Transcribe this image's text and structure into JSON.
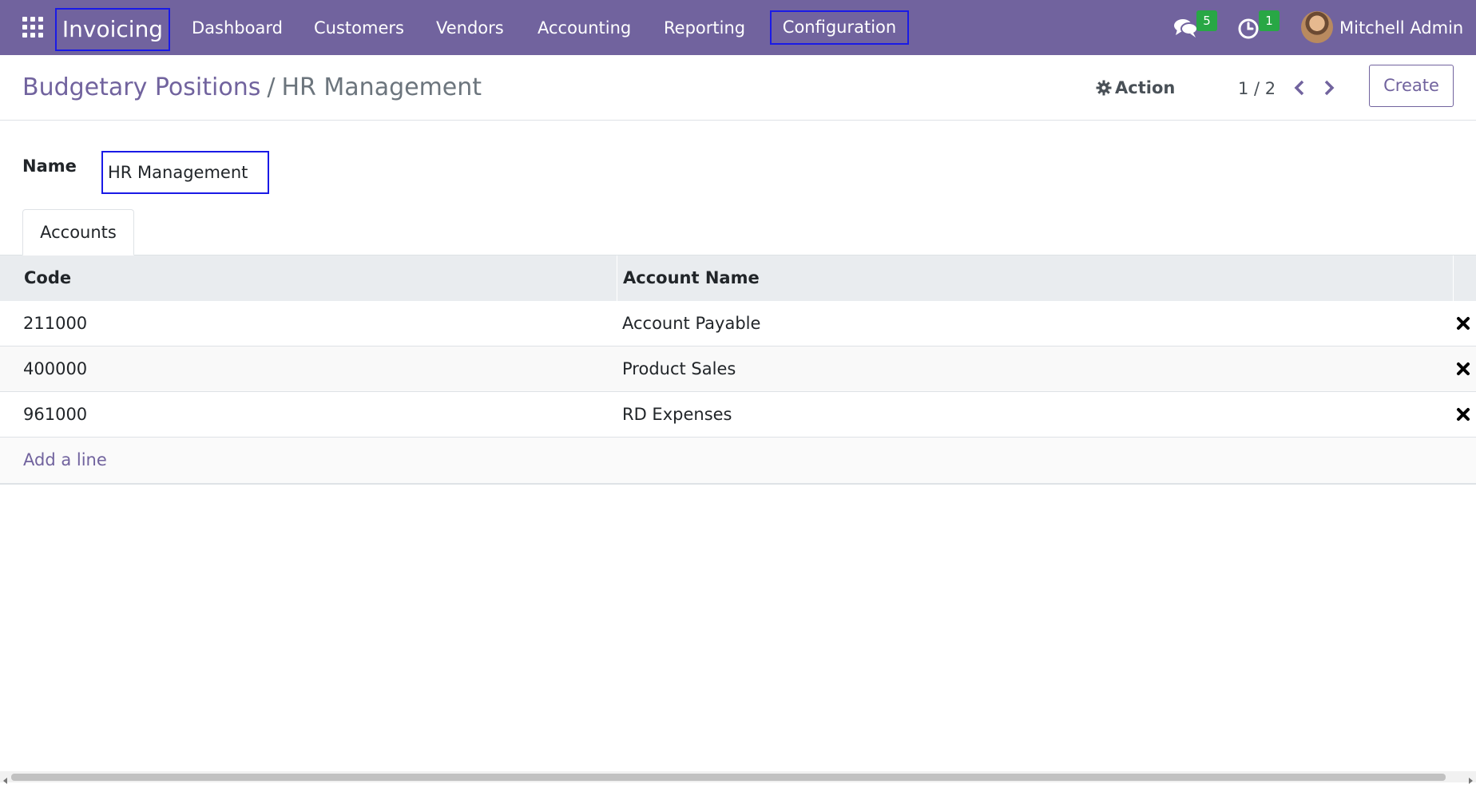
{
  "navbar": {
    "app_name": "Invoicing",
    "menu": [
      "Dashboard",
      "Customers",
      "Vendors",
      "Accounting",
      "Reporting",
      "Configuration"
    ],
    "messages_count": "5",
    "activities_count": "1",
    "user_name": "Mitchell Admin",
    "icons": [
      "apps-grid-icon",
      "chat-icon",
      "clock-icon",
      "avatar"
    ]
  },
  "control_panel": {
    "breadcrumb_parent": "Budgetary Positions",
    "breadcrumb_separator": "/",
    "breadcrumb_current": "HR Management",
    "action_label": "Action",
    "pager": "1 / 2",
    "create_label": "Create"
  },
  "form": {
    "name_label": "Name",
    "name_value": "HR Management",
    "tab_label": "Accounts"
  },
  "accounts_table": {
    "headers": [
      "Code",
      "Account Name"
    ],
    "rows": [
      {
        "code": "211000",
        "name": "Account Payable"
      },
      {
        "code": "400000",
        "name": "Product Sales"
      },
      {
        "code": "961000",
        "name": "RD Expenses"
      }
    ],
    "add_line_label": "Add a line"
  },
  "colors": {
    "brand": "#71639e",
    "badge": "#28a745",
    "highlight_border": "#1a1ae6"
  }
}
